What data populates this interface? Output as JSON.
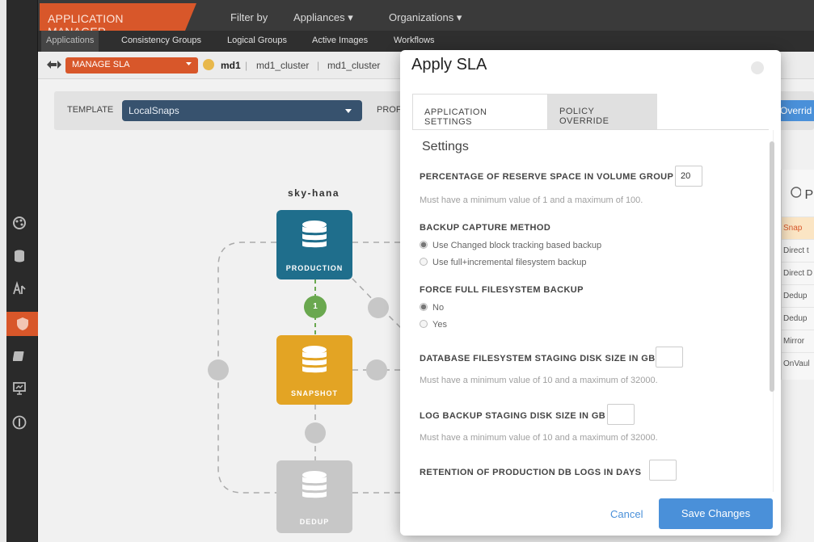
{
  "app": {
    "title": "APPLICATION MANAGER",
    "filter_by": "Filter by",
    "filter_appliances": "Appliances ▾",
    "filter_organizations": "Organizations ▾"
  },
  "tabs": [
    "Applications",
    "Consistency Groups",
    "Logical Groups",
    "Active Images",
    "Workflows"
  ],
  "crumbs": {
    "manage_sla": "MANAGE SLA",
    "app_name": "md1",
    "cluster1": "md1_cluster",
    "cluster2": "md1_cluster",
    "sep": "|"
  },
  "template": {
    "label": "TEMPLATE",
    "value": "LocalSnaps",
    "profile_label": "PROF",
    "override_label": "Overrid"
  },
  "workflow": {
    "host": "sky-hana",
    "nodes": [
      "PRODUCTION",
      "SNAPSHOT",
      "DEDUP"
    ],
    "step": "1"
  },
  "right_panel": {
    "heading": "P",
    "rows": [
      "Snap",
      "Direct t",
      "Direct D",
      "Dedup",
      "Dedup",
      "Mirror",
      "OnVaul"
    ]
  },
  "modal": {
    "title": "Apply SLA",
    "tab_app_settings": "APPLICATION SETTINGS",
    "tab_policy_override": "POLICY OVERRIDE",
    "settings_heading": "Settings",
    "reserve_label": "PERCENTAGE OF RESERVE SPACE IN VOLUME GROUP",
    "reserve_value": "20",
    "reserve_hint": "Must have a minimum value of 1 and a maximum of 100.",
    "capture_label": "BACKUP CAPTURE METHOD",
    "capture_opt1": "Use Changed block tracking based backup",
    "capture_opt2": "Use full+incremental filesystem backup",
    "force_label": "FORCE FULL FILESYSTEM BACKUP",
    "force_no": "No",
    "force_yes": "Yes",
    "db_staging_label": "DATABASE FILESYSTEM STAGING DISK SIZE IN GB",
    "db_staging_value": "",
    "db_staging_hint": "Must have a minimum value of 10 and a maximum of 32000.",
    "log_staging_label": "LOG BACKUP STAGING DISK SIZE IN GB",
    "log_staging_value": "",
    "log_staging_hint": "Must have a minimum value of 10 and a maximum of 32000.",
    "retention_label": "RETENTION OF PRODUCTION DB LOGS IN DAYS",
    "retention_value": "",
    "cancel": "Cancel",
    "save": "Save Changes"
  },
  "colors": {
    "accent_orange": "#d8572a",
    "production_teal": "#1f6e8c",
    "snapshot_amber": "#e3a424",
    "dedup_gray": "#c7c7c7",
    "step_green": "#6aa84f",
    "button_blue": "#4a90d9"
  }
}
